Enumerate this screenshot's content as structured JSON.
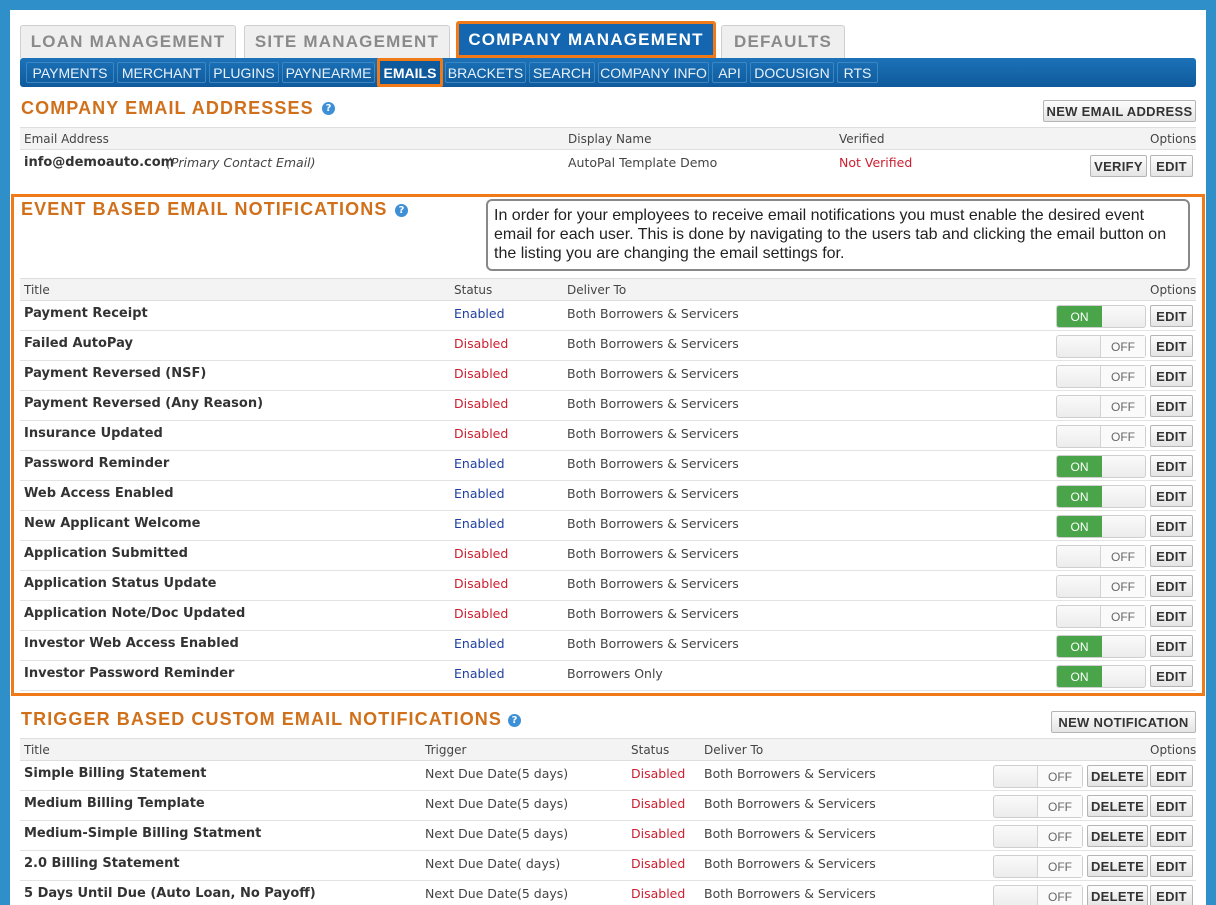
{
  "main_tabs": [
    {
      "label": "LOAN MANAGEMENT"
    },
    {
      "label": "SITE MANAGEMENT"
    },
    {
      "label": "COMPANY MANAGEMENT"
    },
    {
      "label": "DEFAULTS"
    }
  ],
  "sub_tabs": [
    {
      "label": "PAYMENTS"
    },
    {
      "label": "MERCHANT"
    },
    {
      "label": "PLUGINS"
    },
    {
      "label": "PAYNEARME"
    },
    {
      "label": "EMAILS"
    },
    {
      "label": "BRACKETS"
    },
    {
      "label": "SEARCH"
    },
    {
      "label": "COMPANY INFO"
    },
    {
      "label": "API"
    },
    {
      "label": "DOCUSIGN"
    },
    {
      "label": "RTS"
    }
  ],
  "company_emails": {
    "title": "COMPANY EMAIL ADDRESSES",
    "new_button": "NEW EMAIL ADDRESS",
    "headers": {
      "email": "Email Address",
      "display": "Display Name",
      "verified": "Verified",
      "options": "Options"
    },
    "row": {
      "email": "info@demoauto.com",
      "note": "(Primary Contact Email)",
      "display": "AutoPal Template Demo",
      "verified": "Not Verified",
      "verify_button": "VERIFY",
      "edit_button": "EDIT"
    }
  },
  "event_notifications": {
    "title": "EVENT BASED EMAIL NOTIFICATIONS",
    "callout": "In order for your employees to receive email notifications you must enable the desired event email for each user. This is done by navigating to the users tab and clicking the email button on the listing you are changing the email settings for.",
    "headers": {
      "title": "Title",
      "status": "Status",
      "deliver": "Deliver To",
      "options": "Options"
    },
    "on_label": "ON",
    "off_label": "OFF",
    "edit_label": "EDIT",
    "rows": [
      {
        "title": "Payment Receipt",
        "status": "Enabled",
        "deliver": "Both Borrowers & Servicers",
        "on": true
      },
      {
        "title": "Failed AutoPay",
        "status": "Disabled",
        "deliver": "Both Borrowers & Servicers",
        "on": false
      },
      {
        "title": "Payment Reversed (NSF)",
        "status": "Disabled",
        "deliver": "Both Borrowers & Servicers",
        "on": false
      },
      {
        "title": "Payment Reversed (Any Reason)",
        "status": "Disabled",
        "deliver": "Both Borrowers & Servicers",
        "on": false
      },
      {
        "title": "Insurance Updated",
        "status": "Disabled",
        "deliver": "Both Borrowers & Servicers",
        "on": false
      },
      {
        "title": "Password Reminder",
        "status": "Enabled",
        "deliver": "Both Borrowers & Servicers",
        "on": true
      },
      {
        "title": "Web Access Enabled",
        "status": "Enabled",
        "deliver": "Both Borrowers & Servicers",
        "on": true
      },
      {
        "title": "New Applicant Welcome",
        "status": "Enabled",
        "deliver": "Both Borrowers & Servicers",
        "on": true
      },
      {
        "title": "Application Submitted",
        "status": "Disabled",
        "deliver": "Both Borrowers & Servicers",
        "on": false
      },
      {
        "title": "Application Status Update",
        "status": "Disabled",
        "deliver": "Both Borrowers & Servicers",
        "on": false
      },
      {
        "title": "Application Note/Doc Updated",
        "status": "Disabled",
        "deliver": "Both Borrowers & Servicers",
        "on": false
      },
      {
        "title": "Investor Web Access Enabled",
        "status": "Enabled",
        "deliver": "Both Borrowers & Servicers",
        "on": true
      },
      {
        "title": "Investor Password Reminder",
        "status": "Enabled",
        "deliver": "Borrowers Only",
        "on": true
      }
    ]
  },
  "trigger_notifications": {
    "title": "TRIGGER BASED CUSTOM EMAIL NOTIFICATIONS",
    "new_button": "NEW NOTIFICATION",
    "headers": {
      "title": "Title",
      "trigger": "Trigger",
      "status": "Status",
      "deliver": "Deliver To",
      "options": "Options"
    },
    "off_label": "OFF",
    "delete_label": "DELETE",
    "edit_label": "EDIT",
    "rows": [
      {
        "title": "Simple Billing Statement",
        "trigger": "Next Due Date",
        "days": "(5 days)",
        "status": "Disabled",
        "deliver": "Both Borrowers & Servicers"
      },
      {
        "title": "Medium Billing Template",
        "trigger": "Next Due Date",
        "days": "(5 days)",
        "status": "Disabled",
        "deliver": "Both Borrowers & Servicers"
      },
      {
        "title": "Medium-Simple Billing Statment",
        "trigger": "Next Due Date",
        "days": "(5 days)",
        "status": "Disabled",
        "deliver": "Both Borrowers & Servicers"
      },
      {
        "title": "2.0 Billing Statement",
        "trigger": "Next Due Date",
        "days": "( days)",
        "status": "Disabled",
        "deliver": "Both Borrowers & Servicers"
      },
      {
        "title": "5 Days Until Due (Auto Loan, No Payoff)",
        "trigger": "Next Due Date",
        "days": "(5 days)",
        "status": "Disabled",
        "deliver": "Both Borrowers & Servicers"
      }
    ]
  },
  "colors": {
    "accent_orange": "#f07a18",
    "nav_blue": "#1466b0",
    "on_green": "#4aa54a",
    "enabled_blue": "#1f3fa0",
    "disabled_red": "#cc1f2f"
  }
}
